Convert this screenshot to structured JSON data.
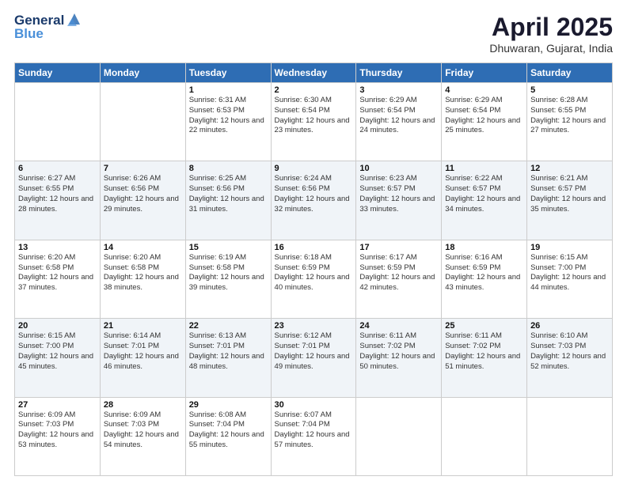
{
  "header": {
    "logo_line1": "General",
    "logo_line2": "Blue",
    "month_title": "April 2025",
    "location": "Dhuwaran, Gujarat, India"
  },
  "weekdays": [
    "Sunday",
    "Monday",
    "Tuesday",
    "Wednesday",
    "Thursday",
    "Friday",
    "Saturday"
  ],
  "weeks": [
    [
      {
        "day": "",
        "sunrise": "",
        "sunset": "",
        "daylight": ""
      },
      {
        "day": "",
        "sunrise": "",
        "sunset": "",
        "daylight": ""
      },
      {
        "day": "1",
        "sunrise": "Sunrise: 6:31 AM",
        "sunset": "Sunset: 6:53 PM",
        "daylight": "Daylight: 12 hours and 22 minutes."
      },
      {
        "day": "2",
        "sunrise": "Sunrise: 6:30 AM",
        "sunset": "Sunset: 6:54 PM",
        "daylight": "Daylight: 12 hours and 23 minutes."
      },
      {
        "day": "3",
        "sunrise": "Sunrise: 6:29 AM",
        "sunset": "Sunset: 6:54 PM",
        "daylight": "Daylight: 12 hours and 24 minutes."
      },
      {
        "day": "4",
        "sunrise": "Sunrise: 6:29 AM",
        "sunset": "Sunset: 6:54 PM",
        "daylight": "Daylight: 12 hours and 25 minutes."
      },
      {
        "day": "5",
        "sunrise": "Sunrise: 6:28 AM",
        "sunset": "Sunset: 6:55 PM",
        "daylight": "Daylight: 12 hours and 27 minutes."
      }
    ],
    [
      {
        "day": "6",
        "sunrise": "Sunrise: 6:27 AM",
        "sunset": "Sunset: 6:55 PM",
        "daylight": "Daylight: 12 hours and 28 minutes."
      },
      {
        "day": "7",
        "sunrise": "Sunrise: 6:26 AM",
        "sunset": "Sunset: 6:56 PM",
        "daylight": "Daylight: 12 hours and 29 minutes."
      },
      {
        "day": "8",
        "sunrise": "Sunrise: 6:25 AM",
        "sunset": "Sunset: 6:56 PM",
        "daylight": "Daylight: 12 hours and 31 minutes."
      },
      {
        "day": "9",
        "sunrise": "Sunrise: 6:24 AM",
        "sunset": "Sunset: 6:56 PM",
        "daylight": "Daylight: 12 hours and 32 minutes."
      },
      {
        "day": "10",
        "sunrise": "Sunrise: 6:23 AM",
        "sunset": "Sunset: 6:57 PM",
        "daylight": "Daylight: 12 hours and 33 minutes."
      },
      {
        "day": "11",
        "sunrise": "Sunrise: 6:22 AM",
        "sunset": "Sunset: 6:57 PM",
        "daylight": "Daylight: 12 hours and 34 minutes."
      },
      {
        "day": "12",
        "sunrise": "Sunrise: 6:21 AM",
        "sunset": "Sunset: 6:57 PM",
        "daylight": "Daylight: 12 hours and 35 minutes."
      }
    ],
    [
      {
        "day": "13",
        "sunrise": "Sunrise: 6:20 AM",
        "sunset": "Sunset: 6:58 PM",
        "daylight": "Daylight: 12 hours and 37 minutes."
      },
      {
        "day": "14",
        "sunrise": "Sunrise: 6:20 AM",
        "sunset": "Sunset: 6:58 PM",
        "daylight": "Daylight: 12 hours and 38 minutes."
      },
      {
        "day": "15",
        "sunrise": "Sunrise: 6:19 AM",
        "sunset": "Sunset: 6:58 PM",
        "daylight": "Daylight: 12 hours and 39 minutes."
      },
      {
        "day": "16",
        "sunrise": "Sunrise: 6:18 AM",
        "sunset": "Sunset: 6:59 PM",
        "daylight": "Daylight: 12 hours and 40 minutes."
      },
      {
        "day": "17",
        "sunrise": "Sunrise: 6:17 AM",
        "sunset": "Sunset: 6:59 PM",
        "daylight": "Daylight: 12 hours and 42 minutes."
      },
      {
        "day": "18",
        "sunrise": "Sunrise: 6:16 AM",
        "sunset": "Sunset: 6:59 PM",
        "daylight": "Daylight: 12 hours and 43 minutes."
      },
      {
        "day": "19",
        "sunrise": "Sunrise: 6:15 AM",
        "sunset": "Sunset: 7:00 PM",
        "daylight": "Daylight: 12 hours and 44 minutes."
      }
    ],
    [
      {
        "day": "20",
        "sunrise": "Sunrise: 6:15 AM",
        "sunset": "Sunset: 7:00 PM",
        "daylight": "Daylight: 12 hours and 45 minutes."
      },
      {
        "day": "21",
        "sunrise": "Sunrise: 6:14 AM",
        "sunset": "Sunset: 7:01 PM",
        "daylight": "Daylight: 12 hours and 46 minutes."
      },
      {
        "day": "22",
        "sunrise": "Sunrise: 6:13 AM",
        "sunset": "Sunset: 7:01 PM",
        "daylight": "Daylight: 12 hours and 48 minutes."
      },
      {
        "day": "23",
        "sunrise": "Sunrise: 6:12 AM",
        "sunset": "Sunset: 7:01 PM",
        "daylight": "Daylight: 12 hours and 49 minutes."
      },
      {
        "day": "24",
        "sunrise": "Sunrise: 6:11 AM",
        "sunset": "Sunset: 7:02 PM",
        "daylight": "Daylight: 12 hours and 50 minutes."
      },
      {
        "day": "25",
        "sunrise": "Sunrise: 6:11 AM",
        "sunset": "Sunset: 7:02 PM",
        "daylight": "Daylight: 12 hours and 51 minutes."
      },
      {
        "day": "26",
        "sunrise": "Sunrise: 6:10 AM",
        "sunset": "Sunset: 7:03 PM",
        "daylight": "Daylight: 12 hours and 52 minutes."
      }
    ],
    [
      {
        "day": "27",
        "sunrise": "Sunrise: 6:09 AM",
        "sunset": "Sunset: 7:03 PM",
        "daylight": "Daylight: 12 hours and 53 minutes."
      },
      {
        "day": "28",
        "sunrise": "Sunrise: 6:09 AM",
        "sunset": "Sunset: 7:03 PM",
        "daylight": "Daylight: 12 hours and 54 minutes."
      },
      {
        "day": "29",
        "sunrise": "Sunrise: 6:08 AM",
        "sunset": "Sunset: 7:04 PM",
        "daylight": "Daylight: 12 hours and 55 minutes."
      },
      {
        "day": "30",
        "sunrise": "Sunrise: 6:07 AM",
        "sunset": "Sunset: 7:04 PM",
        "daylight": "Daylight: 12 hours and 57 minutes."
      },
      {
        "day": "",
        "sunrise": "",
        "sunset": "",
        "daylight": ""
      },
      {
        "day": "",
        "sunrise": "",
        "sunset": "",
        "daylight": ""
      },
      {
        "day": "",
        "sunrise": "",
        "sunset": "",
        "daylight": ""
      }
    ]
  ]
}
